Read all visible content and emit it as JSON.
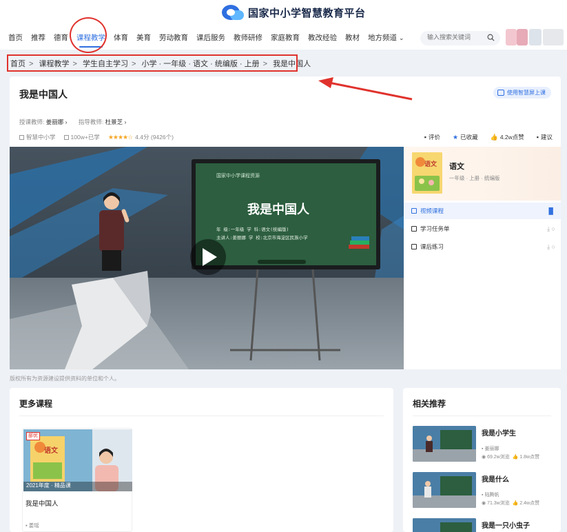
{
  "header": {
    "site_name": "国家中小学智慧教育平台",
    "nav": [
      "首页",
      "推荐",
      "德育",
      "课程教学",
      "体育",
      "美育",
      "劳动教育",
      "课后服务",
      "教师研修",
      "家庭教育",
      "教改经验",
      "教材",
      "地方频道"
    ],
    "active_nav": "课程教学",
    "search_placeholder": "输入搜索关键词"
  },
  "breadcrumb": [
    "首页",
    "课程教学",
    "学生自主学习",
    "小学 · 一年级 · 语文 · 统编版 · 上册",
    "我是中国人"
  ],
  "course": {
    "title": "我是中国人",
    "use_button": "使用智慧屏上课",
    "lecturer_label": "授课教师:",
    "lecturer": "姜丽娜",
    "advisor_label": "指导教师:",
    "advisor": "杜景芝",
    "school": "智慧中小学",
    "views": "100w+已学",
    "stars": "★★★★☆",
    "rating": "4.4分",
    "rating_count": "(9426个)",
    "actions": {
      "review": "评价",
      "favorite": "已收藏",
      "likes": "4.2w点赞",
      "suggest": "建议"
    }
  },
  "video": {
    "screen_header": "国家中小学课程资源",
    "screen_title": "我是中国人",
    "screen_line1": "年  级:一年级      学  科:语文(统编版)",
    "screen_line2": "主讲人:姜丽娜      学  校:北京市海淀区民族小学"
  },
  "side": {
    "book_cover_text": "语文",
    "book_title": "语文",
    "book_sub": "一年级 · 上册 · 统编版",
    "items": [
      {
        "label": "视频课程",
        "right": "▐▌"
      },
      {
        "label": "学习任务单",
        "right": "⤓ ○"
      },
      {
        "label": "课后练习",
        "right": "⤓ ○"
      }
    ]
  },
  "disclaimer": "版权所有为资源建设提供资料的单位和个人。",
  "more_courses": {
    "title": "更多课程",
    "items": [
      {
        "tag": "部优",
        "caption": "2021年度 · 精品课",
        "name": "我是中国人",
        "teacher": "姜瑶",
        "cover_text": "语文"
      }
    ]
  },
  "related": {
    "title": "相关推荐",
    "items": [
      {
        "name": "我是小学生",
        "teacher": "姜丽娜",
        "views": "69.2w浏览",
        "likes": "1.8w点赞"
      },
      {
        "name": "我是什么",
        "teacher": "陆腾帆",
        "views": "71.3w浏览",
        "likes": "2.4w点赞"
      },
      {
        "name": "我是一只小虫子",
        "teacher": "",
        "views": "",
        "likes": ""
      }
    ]
  },
  "colors": {
    "accent": "#2f6fe0",
    "annotation_red": "#e0322d",
    "chalkboard": "#2c5e3f"
  }
}
